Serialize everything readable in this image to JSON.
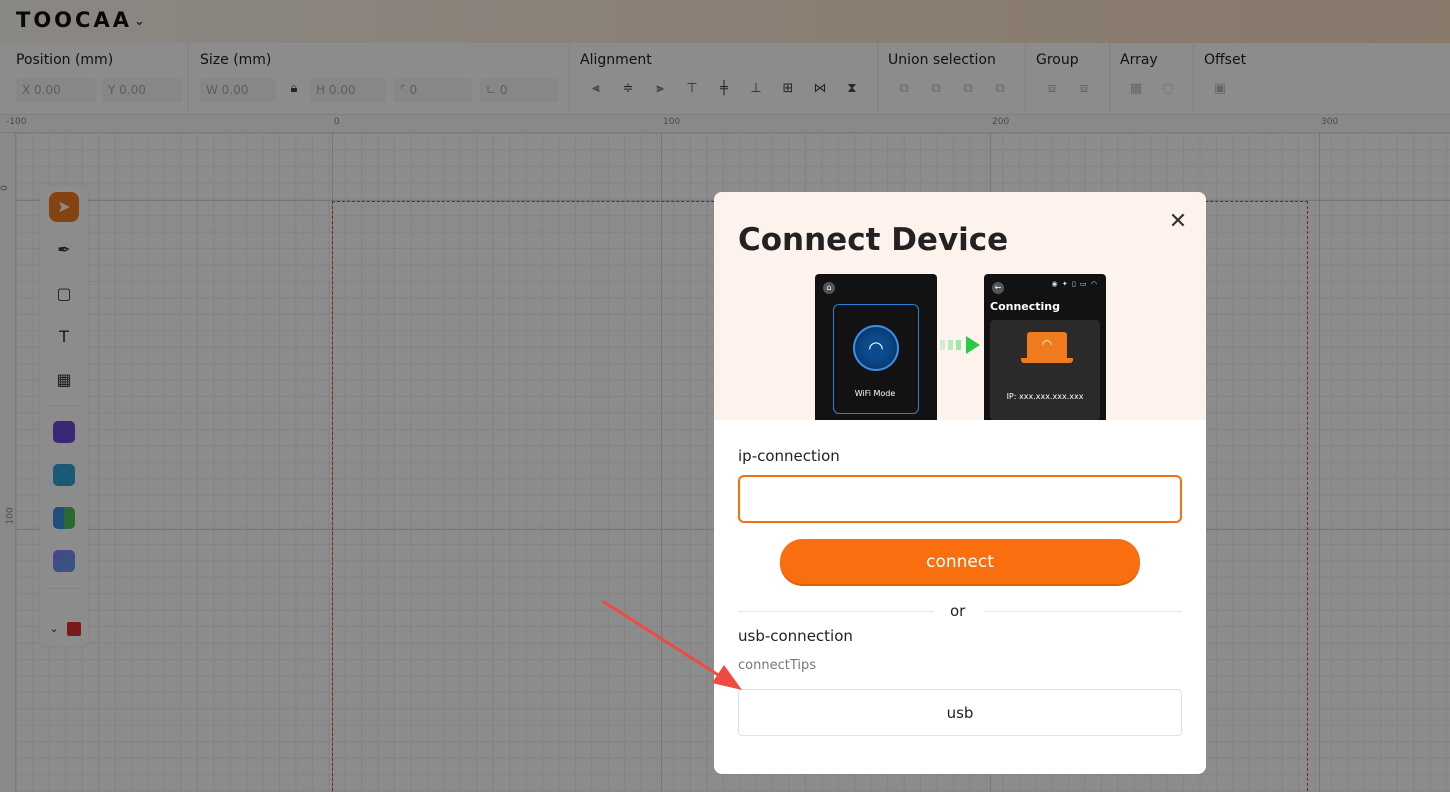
{
  "brand": {
    "name": "TOOCAA",
    "chevron": "⌄"
  },
  "toolbar": {
    "position": {
      "label": "Position (mm)",
      "x_placeholder": "X 0.00",
      "y_placeholder": "Y 0.00"
    },
    "size": {
      "label": "Size (mm)",
      "w_placeholder": "W 0.00",
      "h_placeholder": "H 0.00",
      "corner_placeholder": "0",
      "angle_placeholder": "0"
    },
    "alignment": {
      "label": "Alignment"
    },
    "union": {
      "label": "Union selection"
    },
    "group": {
      "label": "Group"
    },
    "array": {
      "label": "Array"
    },
    "offset": {
      "label": "Offset"
    }
  },
  "ruler": {
    "h_ticks": [
      "-100",
      "0",
      "100",
      "200",
      "300"
    ],
    "v_ticks": [
      "0",
      "100"
    ]
  },
  "modal": {
    "title": "Connect Device",
    "illustration": {
      "left_screen_label": "WiFi Mode",
      "right_screen_title": "Connecting",
      "right_screen_ip": "IP: xxx.xxx.xxx.xxx"
    },
    "ip_section_label": "ip-connection",
    "ip_input_value": "",
    "connect_label": "connect",
    "or_label": "or",
    "usb_section_label": "usb-connection",
    "usb_tips": "connectTips",
    "usb_label": "usb"
  },
  "colors": {
    "accent": "#f96f10",
    "overlay": "rgba(0,0,0,0.45)",
    "workarea_border": "#d84a1b",
    "annotation_arrow": "#f04a45"
  }
}
